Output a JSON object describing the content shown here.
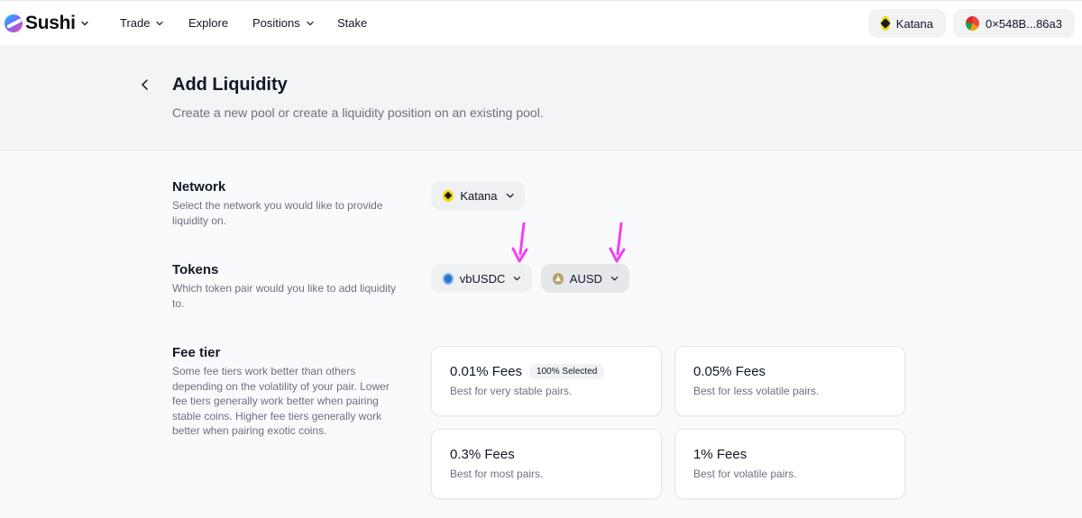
{
  "brand": {
    "name": "Sushi"
  },
  "nav": {
    "items": [
      {
        "label": "Trade",
        "has_menu": true
      },
      {
        "label": "Explore",
        "has_menu": false
      },
      {
        "label": "Positions",
        "has_menu": true
      },
      {
        "label": "Stake",
        "has_menu": false
      }
    ],
    "network_label": "Katana",
    "wallet_address": "0×548B...86a3"
  },
  "header": {
    "title": "Add Liquidity",
    "subtitle": "Create a new pool or create a liquidity position on an existing pool."
  },
  "network": {
    "title": "Network",
    "description": "Select the network you would like to provide liquidity on.",
    "selected": "Katana"
  },
  "tokens": {
    "title": "Tokens",
    "description": "Which token pair would you like to add liquidity to.",
    "token0": "vbUSDC",
    "token1": "AUSD"
  },
  "fee_tier": {
    "title": "Fee tier",
    "description": "Some fee tiers work better than others depending on the volatility of your pair. Lower fee tiers generally work better when pairing stable coins. Higher fee tiers generally work better when pairing exotic coins.",
    "options": [
      {
        "label": "0.01% Fees",
        "desc": "Best for very stable pairs.",
        "badge": "100% Selected"
      },
      {
        "label": "0.05% Fees",
        "desc": "Best for less volatile pairs."
      },
      {
        "label": "0.3% Fees",
        "desc": "Best for most pairs."
      },
      {
        "label": "1% Fees",
        "desc": "Best for volatile pairs."
      }
    ]
  },
  "colors": {
    "annotation_arrow": "#f43ff0",
    "page_bg": "#f9fafb",
    "header_bg": "#f3f4f6",
    "pill_bg": "#eef0f2"
  }
}
